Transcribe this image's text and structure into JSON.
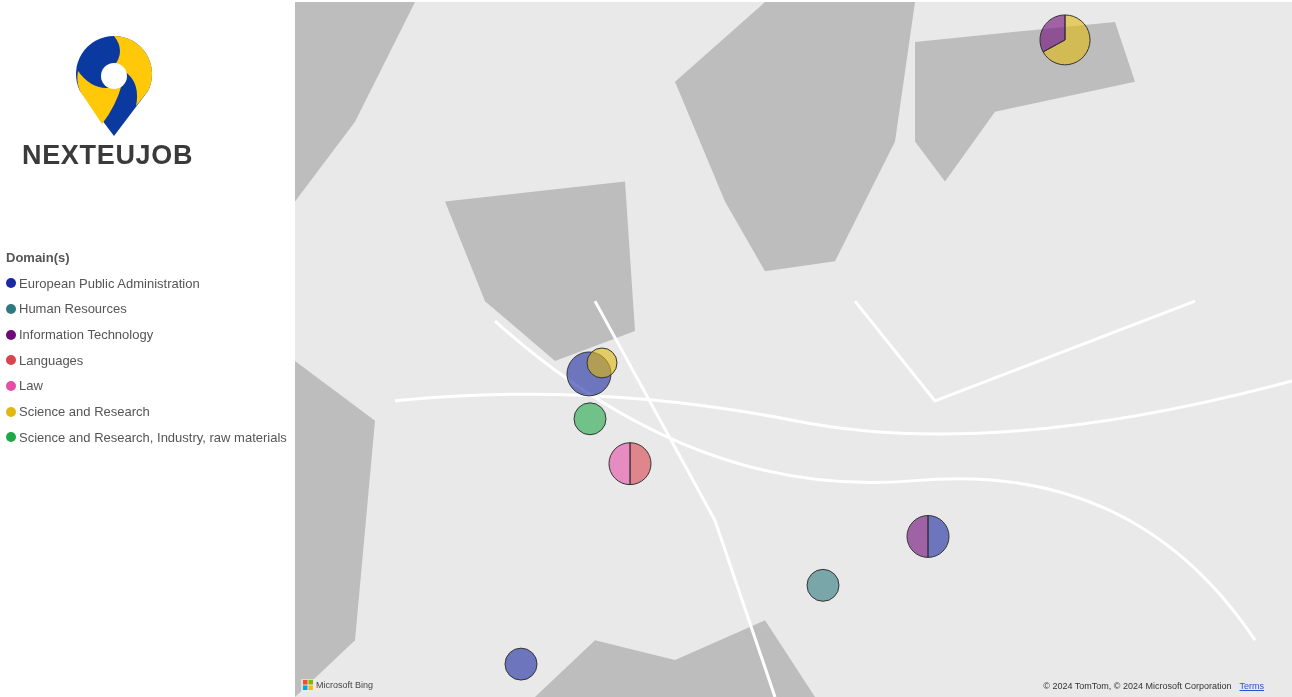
{
  "brand": {
    "name": "NEXTEUJOB"
  },
  "legend": {
    "title": "Domain(s)",
    "items": [
      {
        "label": "European Public Administration",
        "color": "#1a2aa0"
      },
      {
        "label": "Human Resources",
        "color": "#2e7a7f"
      },
      {
        "label": "Information Technology",
        "color": "#6e0a78"
      },
      {
        "label": "Languages",
        "color": "#d9454f"
      },
      {
        "label": "Law",
        "color": "#e64ea7"
      },
      {
        "label": "Science and Research",
        "color": "#e0b80e"
      },
      {
        "label": "Science and Research, Industry, raw materials",
        "color": "#1fa84a"
      }
    ]
  },
  "map": {
    "kind": "picture",
    "provider": "Microsoft Bing",
    "attribution": "© 2024 TomTom, © 2024 Microsoft Corporation",
    "terms_link": "Terms"
  }
}
